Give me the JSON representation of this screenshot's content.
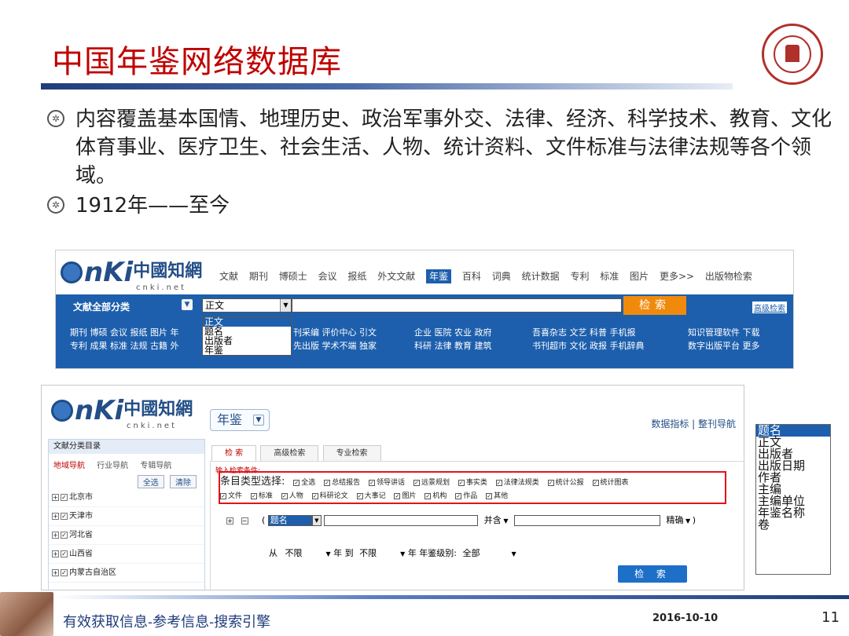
{
  "slide": {
    "title": "中国年鉴网络数据库",
    "bullets": [
      "内容覆盖基本国情、地理历史、政治军事外交、法律、经济、科学技术、教育、文化体育事业、医疗卫生、社会生活、人物、统计资料、文件标准与法律法规等各个领域。",
      "1912年——至今"
    ],
    "footer": {
      "text": "有效获取信息-参考信息-搜索引擎",
      "date": "2016-10-10",
      "page": "11"
    }
  },
  "shot1": {
    "logo_cn": "中國知網",
    "logo_domain": "cnki.net",
    "nav": [
      "文献",
      "期刊",
      "博硕士",
      "会议",
      "报纸",
      "外文文献",
      "年鉴",
      "百科",
      "词典",
      "统计数据",
      "专利",
      "标准",
      "图片",
      "更多>>",
      "出版物检索"
    ],
    "nav_selected": "年鉴",
    "all_category": "文献全部分类",
    "field_value": "正文",
    "field_options": [
      "正文",
      "题名",
      "出版者",
      "年鉴"
    ],
    "search_button": "检索",
    "advanced_link": "高级检索",
    "links": [
      {
        "r1": "期刊 博硕 会议 报纸 图片 年",
        "r2": "专利 成果 标准 法规 古籍 外"
      },
      {
        "r1": "刊采编 评价中心 引文",
        "r2": "先出版 学术不端 独家"
      },
      {
        "r1": "企业 医院 农业 政府",
        "r2": "科研 法律 教育 建筑"
      },
      {
        "r1": "吾喜杂志 文艺 科普 手机报",
        "r2": "书刊超市 文化 政报 手机辞典"
      },
      {
        "r1": "知识管理软件 下载",
        "r2": "数字出版平台 更多"
      }
    ]
  },
  "shot2": {
    "logo_cn": "中國知網",
    "logo_domain": "cnki.net",
    "db_button": "年鉴",
    "top_links": "数据指标 | 整刊导航",
    "sidebar_title": "文献分类目录",
    "sidebar_tabs": [
      "地域导航",
      "行业导航",
      "专辑导航"
    ],
    "select_all": "全选",
    "clear": "清除",
    "regions": [
      "北京市",
      "天津市",
      "河北省",
      "山西省",
      "内蒙古自治区"
    ],
    "tabs": [
      "检 索",
      "高级检索",
      "专业检索"
    ],
    "input_label": "输入检索条件:",
    "type_label": "条目类型选择:",
    "types_row1": [
      "全选",
      "总结报告",
      "领导讲话",
      "远景规划",
      "事实类",
      "法律法规类",
      "统计公报",
      "统计图表"
    ],
    "types_row2": [
      "文件",
      "标准",
      "人物",
      "科研论文",
      "大事记",
      "图片",
      "机构",
      "作品",
      "其他"
    ],
    "query_field": "题名",
    "query_logic": "并含",
    "query_match": "精确",
    "from_label": "从",
    "year_from": "不限",
    "year_to_label": "年 到",
    "year_to": "不限",
    "year_level_label": "年 年鉴级别:",
    "year_level": "全部",
    "search_button": "检 索"
  },
  "field_listbox": {
    "options": [
      "题名",
      "正文",
      "出版者",
      "出版日期",
      "作者",
      "主编",
      "主编单位",
      "年鉴名称",
      "卷"
    ],
    "selected": "题名"
  }
}
